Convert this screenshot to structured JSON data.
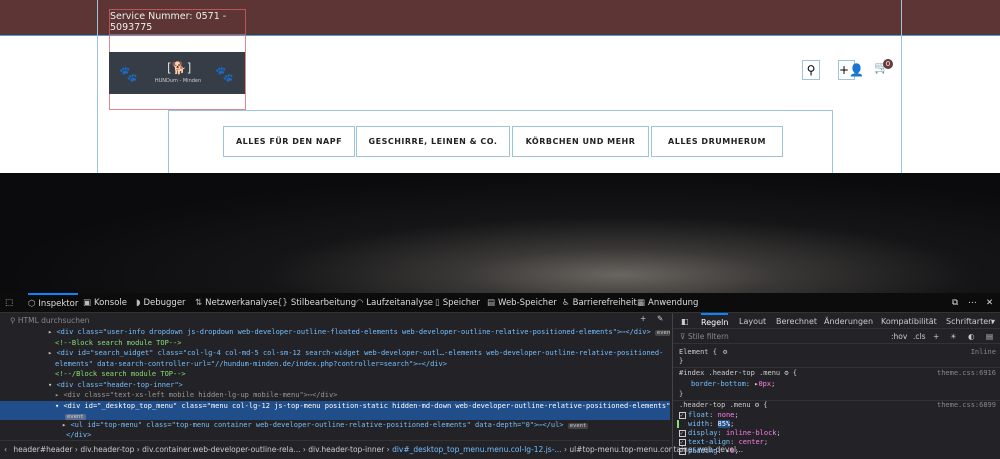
{
  "site": {
    "service": "Service Nummer: 0571 - 5093775",
    "logo_text": "HUNDum - Minden",
    "cart_count": "0",
    "menu": [
      "ALLES FÜR DEN NAPF",
      "GESCHIRRE, LEINEN & CO.",
      "KÖRBCHEN UND MEHR",
      "ALLES DRUMHERUM"
    ]
  },
  "devtools": {
    "tabs": [
      "Inspektor",
      "Konsole",
      "Debugger",
      "Netzwerkanalyse",
      "Stilbearbeitung",
      "Laufzeitanalyse",
      "Speicher",
      "Web-Speicher",
      "Barrierefreiheit",
      "Anwendung"
    ],
    "search_placeholder": "HTML durchsuchen",
    "code": [
      "<div class=\"user-info dropdown js-dropdown web-developer-outline-floated-elements web-developer-outline-relative-positioned-elements\">⋯</div>",
      "<!--Block search module TOP-->",
      "<div id=\"search_widget\" class=\"col-lg-4 col-md-5 col-sm-12 search-widget web-developer-outl…-elements web-developer-outline-relative-positioned-",
      "elements\" data-search-controller-url=\"//hundum-minden.de/index.php?controller=search\">⋯</div>",
      "<!--/Block search module TOP-->",
      "<div class=\"header-top-inner\">",
      "<div class=\"text-xs-left mobile hidden-lg-up mobile-menu\">⋯</div>",
      "<div id=\"_desktop_top_menu\" class=\"menu col-lg-12 js-top-menu position-static hidden-md-down web-developer-outline-relative-positioned-elements\">",
      "<ul id=\"top-menu\" class=\"top-menu container web-developer-outline-relative-positioned-elements\" data-depth=\"0\">⋯</ul>",
      "</div>"
    ],
    "event": "event",
    "breadcrumbs": [
      "header#header",
      "div.header-top",
      "div.container.web-developer-outline-rela...",
      "div.header-top-inner",
      "div#_desktop_top_menu.menu.col-lg-12.js-...",
      "ul#top-menu.top-menu.container.web-devel..."
    ],
    "rule_tabs": [
      "Regeln",
      "Layout",
      "Berechnet",
      "Änderungen",
      "Kompatibilität",
      "Schriftarten"
    ],
    "filter_placeholder": "Stile filtern",
    "hov": ":hov",
    "cls": ".cls",
    "rules": {
      "element": "Element {",
      "inline": "Inline",
      "close": "}",
      "r1_sel": "#index .header-top .menu",
      "r1_src": "theme.css:6916",
      "r1_p": "border-bottom",
      "r1_v": "0px",
      "r2_sel": ".header-top .menu",
      "r2_src": "theme.css:6899",
      "r2_props": [
        [
          "float",
          "none"
        ],
        [
          "width",
          "85%"
        ],
        [
          "display",
          "inline-block"
        ],
        [
          "text-align",
          "center"
        ],
        [
          "padding",
          "0"
        ]
      ]
    }
  }
}
